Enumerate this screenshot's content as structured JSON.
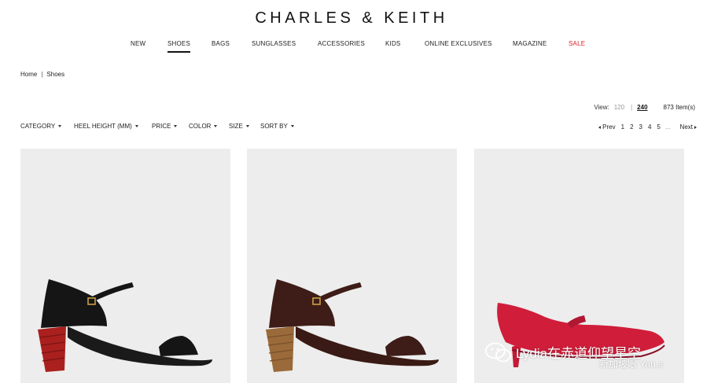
{
  "brand": {
    "logo_text": "CHARLES & KEITH"
  },
  "nav": {
    "items": [
      {
        "label": "NEW",
        "active": false
      },
      {
        "label": "SHOES",
        "active": true
      },
      {
        "label": "BAGS",
        "active": false
      },
      {
        "label": "SUNGLASSES",
        "active": false
      },
      {
        "label": "ACCESSORIES",
        "active": false
      },
      {
        "label": "KIDS",
        "active": false
      },
      {
        "label": "ONLINE EXCLUSIVES",
        "active": false
      },
      {
        "label": "MAGAZINE",
        "active": false
      },
      {
        "label": "SALE",
        "active": false,
        "highlight_color": "#e0202a"
      }
    ]
  },
  "breadcrumb": {
    "home": "Home",
    "separator": "|",
    "current": "Shoes"
  },
  "view": {
    "label": "View:",
    "options": [
      "120",
      "240"
    ],
    "selected": "240",
    "separator": "|",
    "item_count": "873 Item(s)"
  },
  "filters": [
    {
      "label": "CATEGORY"
    },
    {
      "label": "HEEL HEIGHT (MM)"
    },
    {
      "label": "PRICE"
    },
    {
      "label": "COLOR"
    },
    {
      "label": "SIZE"
    },
    {
      "label": "SORT BY"
    }
  ],
  "pagination": {
    "prev": "Prev",
    "pages": [
      "1",
      "2",
      "3",
      "4",
      "5"
    ],
    "ellipsis": "...",
    "next": "Next"
  },
  "products": [
    {
      "name": "black-block-heel-sandal",
      "upper_color": "#151515",
      "heel_color": "#a9201e",
      "sole_color": "#1a1a1a"
    },
    {
      "name": "brown-block-heel-sandal",
      "upper_color": "#3e1c17",
      "heel_color": "#9a6a3a",
      "sole_color": "#3a1a14"
    },
    {
      "name": "red-mary-jane-pump",
      "upper_color": "#d01d3a",
      "heel_color": "#c41a35",
      "sole_color": "#b01732"
    }
  ],
  "watermark": {
    "line1": "Lydia在赤道仰望星空",
    "line2": "新加坡眼 Yan.s"
  }
}
